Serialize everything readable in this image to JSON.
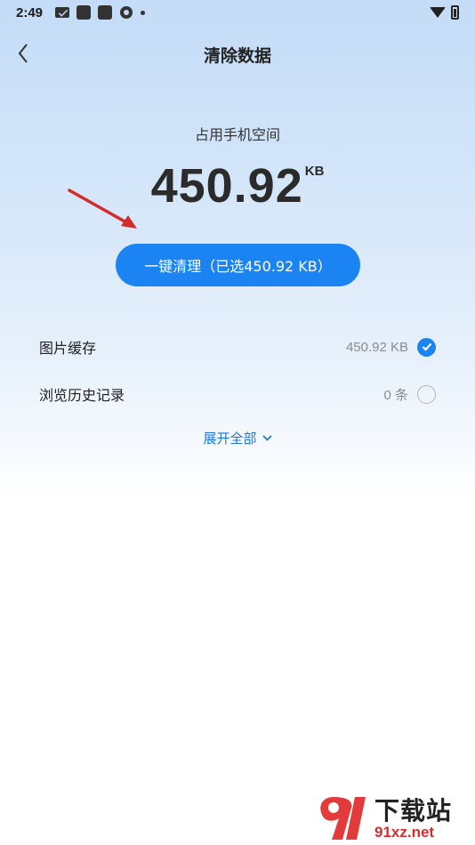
{
  "status_bar": {
    "time": "2:49",
    "icons": [
      "mail-icon",
      "app-square-icon",
      "app-square-icon",
      "camera-icon",
      "dot-icon"
    ],
    "right_icons": [
      "wifi-icon",
      "battery-icon"
    ]
  },
  "header": {
    "title": "清除数据",
    "back_icon": "chevron-left-icon"
  },
  "storage": {
    "subtitle": "占用手机空间",
    "value": "450.92",
    "unit": "KB"
  },
  "clean_button": {
    "label": "一键清理（已选450.92 KB）"
  },
  "items": [
    {
      "label": "图片缓存",
      "value": "450.92 KB",
      "checked": true
    },
    {
      "label": "浏览历史记录",
      "value": "0 条",
      "checked": false
    }
  ],
  "expand": {
    "label": "展开全部",
    "icon": "chevron-down-icon"
  },
  "watermark": {
    "text": "下载站",
    "url": "91xz.net"
  },
  "colors": {
    "accent": "#1b84f2",
    "arrow": "#d42b2b"
  }
}
